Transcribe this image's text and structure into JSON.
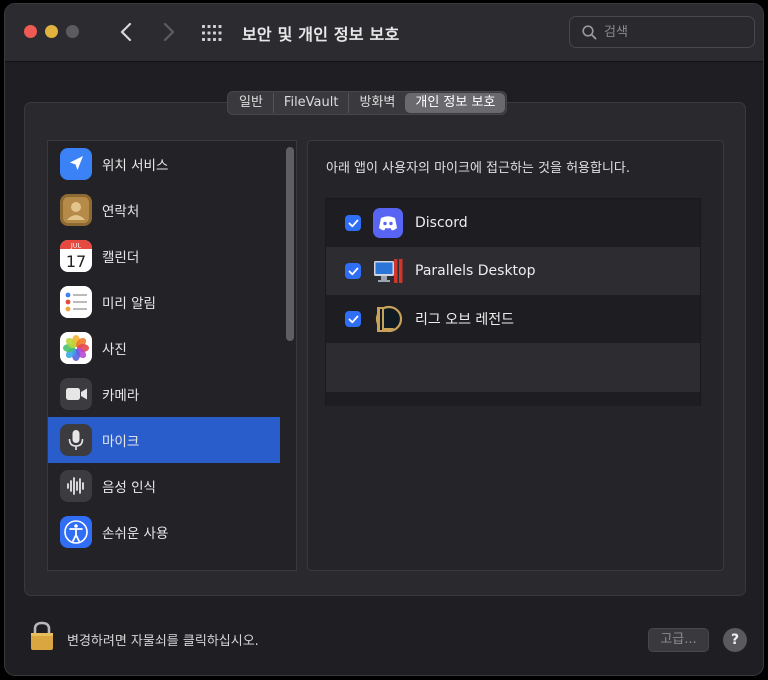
{
  "window": {
    "title": "보안 및 개인 정보 보호"
  },
  "search": {
    "placeholder": "검색",
    "icon": "magnifying-glass-icon"
  },
  "tabs": [
    {
      "label": "일반",
      "active": false
    },
    {
      "label": "FileVault",
      "active": false
    },
    {
      "label": "방화벽",
      "active": false
    },
    {
      "label": "개인 정보 보호",
      "active": true
    }
  ],
  "sidebar": {
    "items": [
      {
        "label": "위치 서비스",
        "icon": "location-arrow-icon",
        "selected": false
      },
      {
        "label": "연락처",
        "icon": "contacts-icon",
        "selected": false
      },
      {
        "label": "캘린더",
        "icon": "calendar-icon",
        "selected": false,
        "month": "JUL",
        "day": "17"
      },
      {
        "label": "미리 알림",
        "icon": "reminders-icon",
        "selected": false
      },
      {
        "label": "사진",
        "icon": "photos-icon",
        "selected": false
      },
      {
        "label": "카메라",
        "icon": "camera-icon",
        "selected": false
      },
      {
        "label": "마이크",
        "icon": "microphone-icon",
        "selected": true
      },
      {
        "label": "음성 인식",
        "icon": "speech-recognition-icon",
        "selected": false
      },
      {
        "label": "손쉬운 사용",
        "icon": "accessibility-icon",
        "selected": false
      }
    ]
  },
  "main": {
    "description": "아래 앱이 사용자의 마이크에 접근하는 것을 허용합니다.",
    "apps": [
      {
        "name": "Discord",
        "checked": true,
        "icon": "discord-icon"
      },
      {
        "name": "Parallels Desktop",
        "checked": true,
        "icon": "parallels-desktop-icon"
      },
      {
        "name": "리그 오브 레전드",
        "checked": true,
        "icon": "league-of-legends-icon"
      }
    ]
  },
  "footer": {
    "lock_text": "변경하려면 자물쇠를 클릭하십시오.",
    "advanced_label": "고급...",
    "help_label": "?"
  },
  "colors": {
    "selection": "#2a5dcc",
    "checkbox": "#2f6ef5",
    "window_bg": "#1f1e23"
  }
}
